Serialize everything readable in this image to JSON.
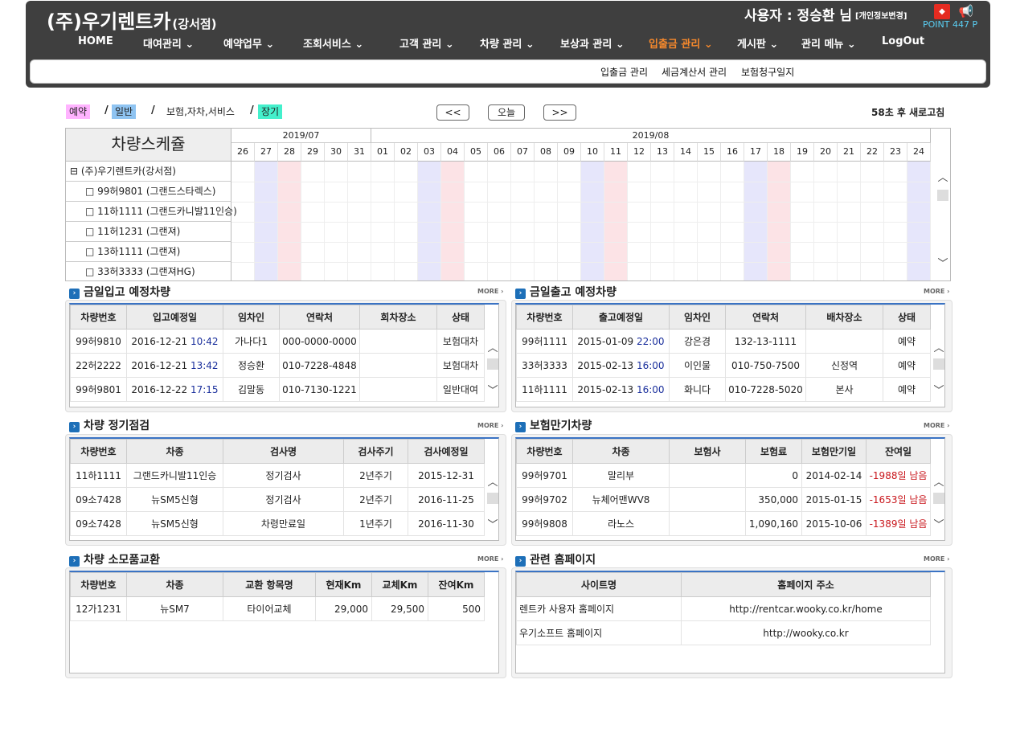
{
  "brand": {
    "name": "(주)우기렌트카",
    "branch": "(강서점)"
  },
  "user": {
    "label": "사용자 : 정승환 님",
    "profile_edit": "[개인정보변경]",
    "points": "POINT 447 P"
  },
  "nav": [
    {
      "label": "HOME"
    },
    {
      "label": "대여관리 ⌄"
    },
    {
      "label": "예약업무 ⌄"
    },
    {
      "label": "조회서비스 ⌄"
    },
    {
      "label": "고객 관리 ⌄"
    },
    {
      "label": "차량 관리 ⌄"
    },
    {
      "label": "보상과 관리 ⌄"
    },
    {
      "label": "입출금 관리 ⌄"
    },
    {
      "label": "게시판 ⌄"
    },
    {
      "label": "관리 메뉴 ⌄"
    },
    {
      "label": "LogOut"
    }
  ],
  "subnav": [
    "입출금 관리",
    "세금계산서 관리",
    "보험청구일지"
  ],
  "legend": {
    "reserve": "예약",
    "normal": "일반",
    "insurance": "보험,자차,서비스",
    "long": "장기",
    "slash": "/"
  },
  "datenav": {
    "prev": "<<",
    "today": "오늘",
    "next": ">>",
    "refresh": "58초 후 새로고침"
  },
  "schedule": {
    "title": "차량스케쥴",
    "months": [
      "2019/07",
      "2019/08"
    ],
    "days": [
      "26",
      "27",
      "28",
      "29",
      "30",
      "31",
      "01",
      "02",
      "03",
      "04",
      "05",
      "06",
      "07",
      "08",
      "09",
      "10",
      "11",
      "12",
      "13",
      "14",
      "15",
      "16",
      "17",
      "18",
      "19",
      "20",
      "21",
      "22",
      "23",
      "24"
    ],
    "tree": [
      "⊟ (주)우기렌트카(강서점)",
      "□ 99허9801 (그랜드스타렉스)",
      "□ 11하1111 (그랜드카니발11인승)",
      "□ 11허1231 (그랜져)",
      "□ 13하1111 (그랜져)",
      "□ 33허3333 (그랜져HG)"
    ]
  },
  "colors": {
    "reserve": "#ffb3ff",
    "normal": "#8fc4f2",
    "long": "#44f0cc",
    "sat": "#e6e6fb",
    "sun": "#fce3e6",
    "active_nav": "#f7892c",
    "header_bg": "#3f3f3f"
  },
  "sections": {
    "more": "MORE ›",
    "return": "금일입고 예정차량",
    "release": "금일출고 예정차량",
    "inspect": "차량 정기점검",
    "insure": "보험만기차량",
    "consume": "차량 소모품교환",
    "links": "관련 홈페이지"
  },
  "return_table": {
    "headers": [
      "차량번호",
      "입고예정일",
      "임차인",
      "연락처",
      "회차장소",
      "상태"
    ],
    "rows": [
      [
        "99허9810",
        "2016-12-21",
        "10:42",
        "가나다1",
        "000-0000-0000",
        "",
        "보험대차"
      ],
      [
        "22허2222",
        "2016-12-21",
        "13:42",
        "정승환",
        "010-7228-4848",
        "",
        "보험대차"
      ],
      [
        "99허9801",
        "2016-12-22",
        "17:15",
        "김말동",
        "010-7130-1221",
        "",
        "일반대여"
      ]
    ]
  },
  "release_table": {
    "headers": [
      "차량번호",
      "출고예정일",
      "임차인",
      "연락처",
      "배차장소",
      "상태"
    ],
    "rows": [
      [
        "99허1111",
        "2015-01-09",
        "22:00",
        "강은경",
        "132-13-1111",
        "",
        "예약"
      ],
      [
        "33허3333",
        "2015-02-13",
        "16:00",
        "이인물",
        "010-750-7500",
        "신정역",
        "예약"
      ],
      [
        "11하1111",
        "2015-02-13",
        "16:00",
        "화니다",
        "010-7228-5020",
        "본사",
        "예약"
      ]
    ]
  },
  "inspect_table": {
    "headers": [
      "차량번호",
      "차종",
      "검사명",
      "검사주기",
      "검사예정일"
    ],
    "rows": [
      [
        "11하1111",
        "그랜드카니발11인승",
        "정기검사",
        "2년주기",
        "2015-12-31"
      ],
      [
        "09소7428",
        "뉴SM5신형",
        "정기검사",
        "2년주기",
        "2016-11-25"
      ],
      [
        "09소7428",
        "뉴SM5신형",
        "차령만료일",
        "1년주기",
        "2016-11-30"
      ]
    ]
  },
  "insure_table": {
    "headers": [
      "차량번호",
      "차종",
      "보험사",
      "보험료",
      "보험만기일",
      "잔여일"
    ],
    "rows": [
      [
        "99허9701",
        "말리부",
        "",
        "0",
        "2014-02-14",
        "-1988일 남음"
      ],
      [
        "99허9702",
        "뉴체어맨WV8",
        "",
        "350,000",
        "2015-01-15",
        "-1653일 남음"
      ],
      [
        "99허9808",
        "라노스",
        "",
        "1,090,160",
        "2015-10-06",
        "-1389일 남음"
      ]
    ]
  },
  "consume_table": {
    "headers": [
      "차량번호",
      "차종",
      "교환 항목명",
      "현재Km",
      "교체Km",
      "잔여Km"
    ],
    "rows": [
      [
        "12가1231",
        "뉴SM7",
        "타이어교체",
        "29,000",
        "29,500",
        "500"
      ]
    ]
  },
  "links_table": {
    "headers": [
      "사이트명",
      "홈페이지 주소"
    ],
    "rows": [
      [
        "렌트카 사용자 홈페이지",
        "http://rentcar.wooky.co.kr/home"
      ],
      [
        "우기소프트 홈페이지",
        "http://wooky.co.kr"
      ]
    ]
  }
}
